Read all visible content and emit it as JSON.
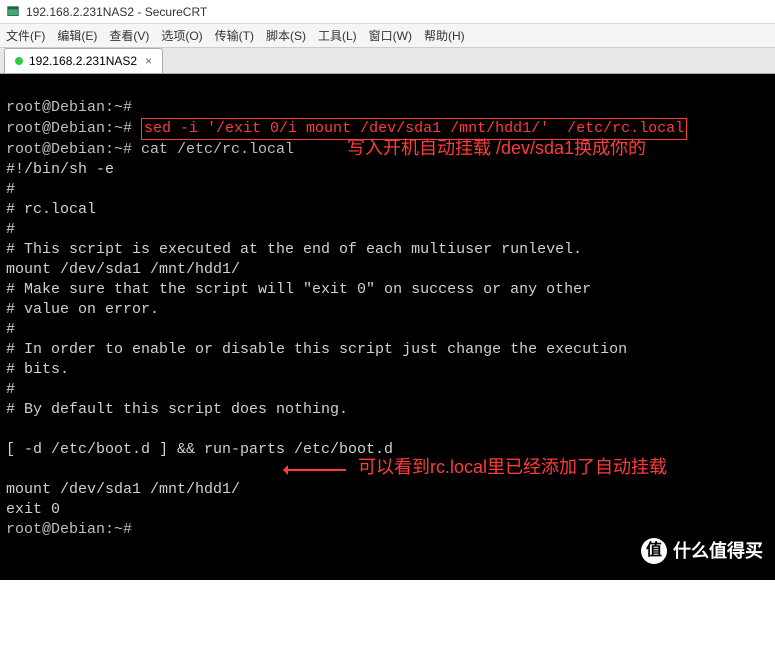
{
  "window": {
    "title": "192.168.2.231NAS2 - SecureCRT"
  },
  "menu": {
    "items": [
      "文件(F)",
      "编辑(E)",
      "查看(V)",
      "选项(O)",
      "传输(T)",
      "脚本(S)",
      "工具(L)",
      "窗口(W)",
      "帮助(H)"
    ]
  },
  "tab": {
    "label": "192.168.2.231NAS2",
    "status_color": "#2ecc40",
    "close_glyph": "×"
  },
  "terminal": {
    "prompt": "root@Debian:~# ",
    "highlighted_cmd": "sed -i '/exit 0/i mount /dev/sda1 /mnt/hdd1/'  /etc/rc.local",
    "lines": [
      "root@Debian:~# ",
      "root@Debian:~# cat /etc/rc.local",
      "#!/bin/sh -e",
      "#",
      "# rc.local",
      "#",
      "# This script is executed at the end of each multiuser runlevel.",
      "mount /dev/sda1 /mnt/hdd1/",
      "# Make sure that the script will \"exit 0\" on success or any other",
      "# value on error.",
      "#",
      "# In order to enable or disable this script just change the execution",
      "# bits.",
      "#",
      "# By default this script does nothing.",
      "",
      "[ -d /etc/boot.d ] && run-parts /etc/boot.d",
      "",
      "mount /dev/sda1 /mnt/hdd1/",
      "exit 0",
      "root@Debian:~# "
    ]
  },
  "annotations": {
    "top": "写入开机自动挂载 /dev/sda1换成你的",
    "bottom": "可以看到rc.local里已经添加了自动挂载"
  },
  "watermark": {
    "glyph": "值",
    "text": "什么值得买"
  }
}
